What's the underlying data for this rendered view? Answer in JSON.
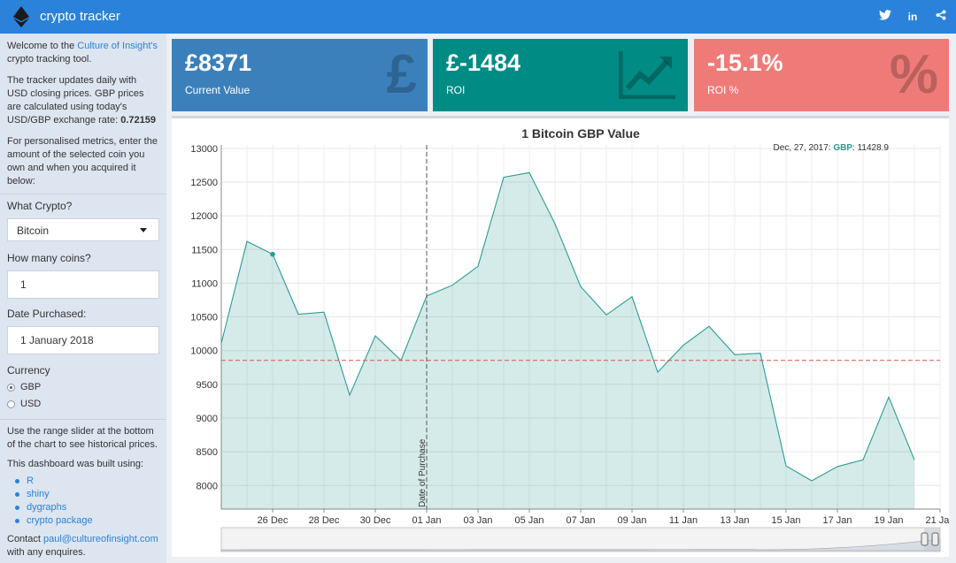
{
  "header": {
    "title": "crypto tracker",
    "icons": [
      "twitter-icon",
      "linkedin-icon",
      "share-icon"
    ]
  },
  "sidebar": {
    "welcome_prefix": "Welcome to the ",
    "welcome_link": "Culture of Insight's",
    "welcome_suffix": " crypto tracking tool.",
    "update_text": "The tracker updates daily with USD closing prices. GBP prices are calculated using today's USD/GBP exchange rate:",
    "exchange_rate": "0.72159",
    "personal_text": "For personalised metrics, enter the amount of the selected coin you own and when you acquired it below:",
    "crypto_label": "What Crypto?",
    "crypto_value": "Bitcoin",
    "coins_label": "How many coins?",
    "coins_value": "1",
    "date_label": "Date Purchased:",
    "date_value": "1 January 2018",
    "currency_label": "Currency",
    "currency_options": [
      "GBP",
      "USD"
    ],
    "currency_selected": "GBP",
    "range_text": "Use the range slider at the bottom of the chart to see historical prices.",
    "built_text": "This dashboard was built using:",
    "built_items": [
      "R",
      "shiny",
      "dygraphs",
      "crypto package"
    ],
    "contact_prefix": "Contact ",
    "contact_email": "paul@cultureofinsight.com",
    "contact_suffix": "with any enquires."
  },
  "value_boxes": [
    {
      "value": "£8371",
      "label": "Current Value",
      "icon": "pound-sign-icon",
      "color": "#3c80bb"
    },
    {
      "value": "£-1484",
      "label": "ROI",
      "icon": "line-chart-icon",
      "color": "#008b85"
    },
    {
      "value": "-15.1%",
      "label": "ROI %",
      "icon": "percent-icon",
      "color": "#ef7b78"
    }
  ],
  "chart_data": {
    "type": "area",
    "title": "1 Bitcoin GBP Value",
    "series": [
      {
        "name": "GBP",
        "color": "#2c9c93"
      }
    ],
    "x": [
      "2017-12-24",
      "2017-12-25",
      "2017-12-26",
      "2017-12-27",
      "2017-12-28",
      "2017-12-29",
      "2017-12-30",
      "2017-12-31",
      "2018-01-01",
      "2018-01-02",
      "2018-01-03",
      "2018-01-04",
      "2018-01-05",
      "2018-01-06",
      "2018-01-07",
      "2018-01-08",
      "2018-01-09",
      "2018-01-10",
      "2018-01-11",
      "2018-01-12",
      "2018-01-13",
      "2018-01-14",
      "2018-01-15",
      "2018-01-16",
      "2018-01-17",
      "2018-01-18",
      "2018-01-19",
      "2018-01-20",
      "2018-01-21"
    ],
    "values": [
      10110,
      11620,
      11429,
      10540,
      10570,
      9340,
      10220,
      9855,
      10810,
      10970,
      11250,
      12570,
      12640,
      11880,
      10950,
      10530,
      10800,
      9680,
      10080,
      10360,
      9940,
      9960,
      8290,
      8070,
      8280,
      8380,
      9310,
      8380,
      null
    ],
    "highlight": {
      "date": "Dec, 27, 2017",
      "series": "GBP",
      "value": "11428.9"
    },
    "reference_line": {
      "value": 9855,
      "color": "#d9534f"
    },
    "event_line": {
      "date": "2018-01-01",
      "label": "Date of Purchase"
    },
    "x_tick_labels": [
      "26 Dec",
      "28 Dec",
      "30 Dec",
      "01 Jan",
      "03 Jan",
      "05 Jan",
      "07 Jan",
      "09 Jan",
      "11 Jan",
      "13 Jan",
      "15 Jan",
      "17 Jan",
      "19 Jan",
      "21 Jan"
    ],
    "y_ticks": [
      8000,
      8500,
      9000,
      9500,
      10000,
      10500,
      11000,
      11500,
      12000,
      12500,
      13000
    ],
    "ylim": [
      7650,
      13050
    ],
    "grid": true,
    "range_selector": true
  }
}
